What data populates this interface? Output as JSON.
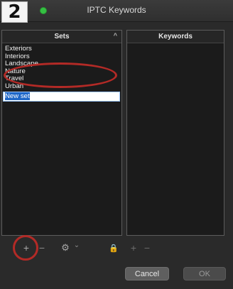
{
  "window": {
    "title": "IPTC Keywords"
  },
  "annotation": {
    "step_number": "2"
  },
  "sets_panel": {
    "header": "Sets",
    "sort_icon": "chevron-up-icon",
    "items": [
      "Exteriors",
      "Interiors",
      "Landscape",
      "Nature",
      "Travel",
      "Urban"
    ],
    "editing_value": "New set"
  },
  "keywords_panel": {
    "header": "Keywords"
  },
  "toolbar": {
    "add_set": "+",
    "remove_set": "−",
    "gear": "⚙",
    "gear_menu": "⌄",
    "lock": "🔒",
    "add_keyword": "+",
    "remove_keyword": "−"
  },
  "buttons": {
    "cancel": "Cancel",
    "ok": "OK"
  },
  "colors": {
    "annotation_red": "#b32a26",
    "selection_blue": "#1e67c8",
    "traffic_green": "#35c043"
  }
}
